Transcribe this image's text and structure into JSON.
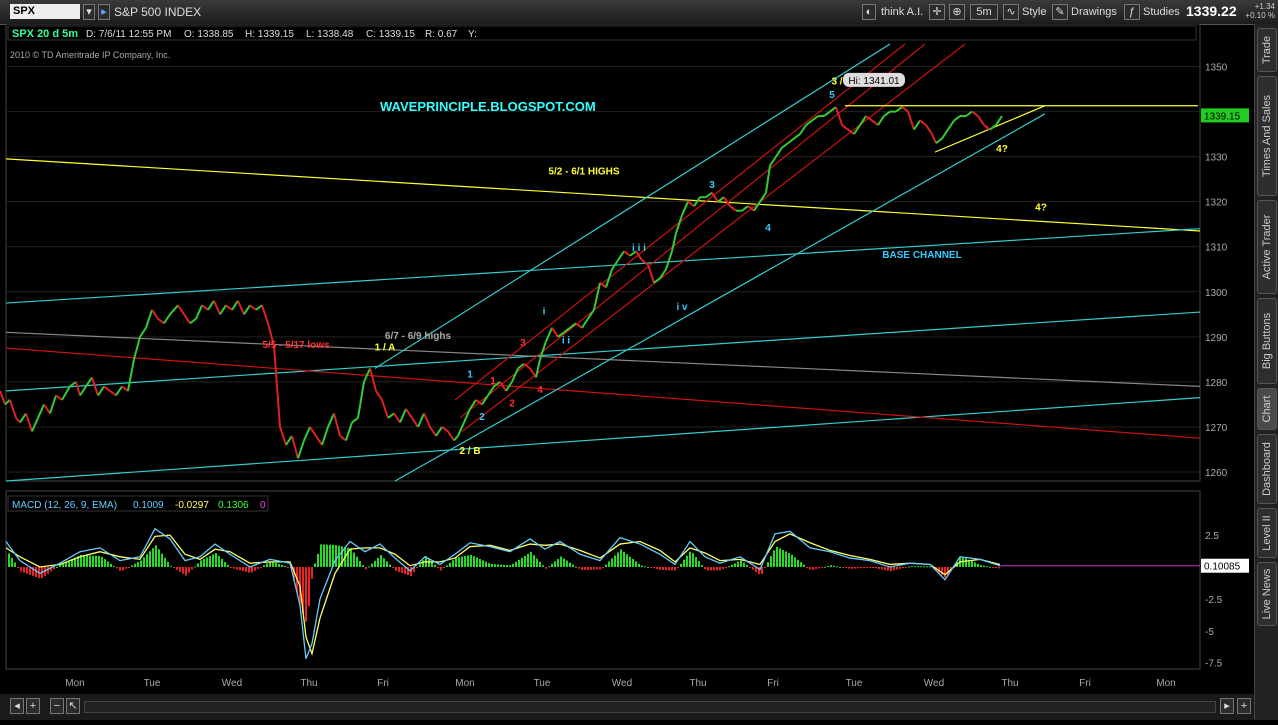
{
  "toolbar": {
    "symbol": "SPX",
    "name": "S&P 500 INDEX",
    "think": "think A.I.",
    "timeframe": "5m",
    "style": "Style",
    "drawings": "Drawings",
    "studies": "Studies",
    "last": "1339.22",
    "change": "+1.34",
    "change_pct": "+0.10 %"
  },
  "sidebar": {
    "tabs": [
      "Trade",
      "Times And Sales",
      "Active Trader",
      "Big Buttons",
      "Chart",
      "Dashboard",
      "Level II",
      "Live News"
    ]
  },
  "colors": {
    "price_up": "#33cc33",
    "price_down": "#dd2222",
    "cyan": "#33cccc",
    "yellow": "#ffff33",
    "red_channel": "#cc1111",
    "gray_line": "#888888",
    "macd_line": "#66ccff",
    "signal_line": "#ffff66",
    "hist_up": "#22dd22",
    "hist_down": "#ee2222",
    "grid": "#222222"
  },
  "chart_data": [
    {
      "type": "line",
      "header": {
        "symbol": "SPX 20 d 5m",
        "date": "D: 7/6/11 12:55 PM",
        "open": "O: 1338.85",
        "high": "H: 1339.15",
        "low": "L: 1338.48",
        "close": "C: 1339.15",
        "range": "R: 0.67",
        "y": "Y:"
      },
      "copyright": "2010 © TD Ameritrade IP Company, Inc.",
      "title": "WAVEPRINCIPLE.BLOGSPOT.COM",
      "x_labels": [
        "Mon",
        "Tue",
        "Wed",
        "Thu",
        "Fri",
        "Mon",
        "Tue",
        "Wed",
        "Thu",
        "Fri",
        "Tue",
        "Wed",
        "Thu",
        "Fri",
        "Mon"
      ],
      "ylim": [
        1258,
        1355
      ],
      "y_ticks": [
        1350,
        1340,
        1330,
        1320,
        1310,
        1300,
        1290,
        1280,
        1270,
        1260
      ],
      "current_price_label": "1339.15",
      "hi_label": "Hi: 1341.01",
      "x": [
        0,
        5,
        10,
        16,
        20,
        26,
        32,
        38,
        44,
        50,
        56,
        62,
        70,
        76,
        80,
        86,
        92,
        98,
        104,
        110,
        116,
        122,
        128,
        134,
        140,
        146,
        152,
        158,
        164,
        170,
        178,
        184,
        190,
        196,
        202,
        208,
        214,
        220,
        226,
        232,
        238,
        244,
        250,
        256,
        262,
        268,
        274,
        280,
        286,
        292,
        298,
        304,
        310,
        316,
        322,
        328,
        334,
        340,
        346,
        352,
        358,
        364,
        370,
        376,
        382,
        388,
        394,
        400,
        406,
        412,
        418,
        424,
        430,
        436,
        442,
        448,
        454,
        458,
        464,
        470,
        476,
        482,
        488,
        494,
        500,
        506,
        512,
        518,
        524,
        530,
        536,
        540,
        546,
        552,
        558,
        564,
        570,
        576,
        582,
        588,
        594,
        600,
        606,
        612,
        618,
        624,
        630,
        636,
        642,
        648,
        654,
        660,
        666,
        672,
        676,
        682,
        688,
        694,
        700,
        706,
        712,
        718,
        724,
        730,
        736,
        742,
        748,
        754,
        760,
        766,
        770,
        776,
        782,
        788,
        794,
        800,
        806,
        812,
        818,
        824,
        830,
        836,
        842,
        848,
        854,
        860,
        866,
        872,
        878,
        884,
        890,
        896,
        902,
        908,
        914,
        920,
        926,
        932,
        936,
        942,
        948,
        954,
        960,
        966,
        972,
        978,
        984,
        990,
        996,
        1002
      ],
      "values": [
        1278,
        1275,
        1276,
        1272,
        1271,
        1273,
        1269,
        1272,
        1275,
        1273,
        1277,
        1276,
        1279,
        1280,
        1277,
        1279,
        1281,
        1277,
        1279,
        1278,
        1277,
        1279,
        1278,
        1285,
        1290,
        1292,
        1296,
        1294,
        1293,
        1295,
        1297,
        1295,
        1293,
        1294,
        1297,
        1296,
        1298,
        1295,
        1297,
        1296,
        1298,
        1295,
        1297,
        1296,
        1297,
        1293,
        1288,
        1270,
        1266,
        1268,
        1263,
        1267,
        1270,
        1268,
        1266,
        1270,
        1273,
        1268,
        1267,
        1271,
        1272,
        1280,
        1283,
        1278,
        1276,
        1272,
        1273,
        1271,
        1274,
        1272,
        1270,
        1273,
        1270,
        1268,
        1270,
        1269,
        1267,
        1268,
        1271,
        1274,
        1276,
        1275,
        1277,
        1279,
        1280,
        1278,
        1280,
        1283,
        1284,
        1283,
        1281,
        1285,
        1289,
        1292,
        1290,
        1291,
        1292,
        1293,
        1292,
        1294,
        1296,
        1302,
        1301,
        1305,
        1307,
        1309,
        1308,
        1309,
        1307,
        1306,
        1302,
        1303,
        1305,
        1309,
        1313,
        1317,
        1320,
        1319,
        1321,
        1321,
        1322,
        1320,
        1321,
        1319,
        1318,
        1318,
        1319,
        1318,
        1320,
        1322,
        1328,
        1330,
        1332,
        1333,
        1334,
        1335,
        1337,
        1338,
        1339,
        1339,
        1340,
        1341,
        1337,
        1336,
        1335,
        1337,
        1339,
        1338,
        1337,
        1339,
        1340,
        1340,
        1341,
        1340,
        1336,
        1338,
        1337,
        1335,
        1333,
        1334,
        1336,
        1338,
        1339,
        1339,
        1340,
        1339,
        1337,
        1336,
        1337,
        1339
      ],
      "labels": [
        {
          "text": "5/5 - 5/17 lows",
          "color": "#ff3333",
          "x": 296,
          "v": 1287.5
        },
        {
          "text": "6/7 - 6/9 highs",
          "color": "#aaaaaa",
          "x": 418,
          "v": 1289.5
        },
        {
          "text": "1 / A",
          "color": "#ffff33",
          "x": 385,
          "v": 1287
        },
        {
          "text": "2 / B",
          "color": "#ffff33",
          "x": 470,
          "v": 1264
        },
        {
          "text": "3 / C",
          "color": "#ffff33",
          "x": 842,
          "v": 1346
        },
        {
          "text": "5",
          "color": "#33ccff",
          "x": 832,
          "v": 1343
        },
        {
          "text": "5/2 - 6/1 HIGHS",
          "color": "#ffff33",
          "x": 584,
          "v": 1326
        },
        {
          "text": "BASE CHANNEL",
          "color": "#33ccff",
          "x": 922,
          "v": 1307.5
        },
        {
          "text": "4?",
          "color": "#ffff33",
          "x": 1002,
          "v": 1331
        },
        {
          "text": "4?",
          "color": "#ffff33",
          "x": 1041,
          "v": 1318
        },
        {
          "text": "3",
          "color": "#33ccff",
          "x": 712,
          "v": 1323
        },
        {
          "text": "4",
          "color": "#33ccff",
          "x": 768,
          "v": 1313.5
        },
        {
          "text": "i i i",
          "color": "#33ccff",
          "x": 639,
          "v": 1309
        },
        {
          "text": "i v",
          "color": "#33ccff",
          "x": 682,
          "v": 1296
        },
        {
          "text": "i",
          "color": "#33ccff",
          "x": 544,
          "v": 1295
        },
        {
          "text": "i i",
          "color": "#33ccff",
          "x": 566,
          "v": 1288.5
        },
        {
          "text": "1",
          "color": "#33ccff",
          "x": 470,
          "v": 1281
        },
        {
          "text": "2",
          "color": "#33ccff",
          "x": 482,
          "v": 1271.5
        },
        {
          "text": "1",
          "color": "#ff3333",
          "x": 493,
          "v": 1279.5
        },
        {
          "text": "2",
          "color": "#ff3333",
          "x": 512,
          "v": 1274.5
        },
        {
          "text": "3",
          "color": "#ff3333",
          "x": 523,
          "v": 1288
        },
        {
          "text": "4",
          "color": "#ff3333",
          "x": 540,
          "v": 1277.5
        }
      ],
      "trendlines": [
        {
          "color": "#ffff33",
          "from": [
            6,
            1329.5
          ],
          "to": [
            1200,
            1313.5
          ]
        },
        {
          "color": "#33cccc",
          "from": [
            6,
            1297.5
          ],
          "to": [
            1200,
            1314
          ]
        },
        {
          "color": "#33cccc",
          "from": [
            6,
            1278
          ],
          "to": [
            1200,
            1295.5
          ]
        },
        {
          "color": "#33cccc",
          "from": [
            6,
            1258
          ],
          "to": [
            1200,
            1276.5
          ]
        },
        {
          "color": "#888888",
          "from": [
            6,
            1291
          ],
          "to": [
            1200,
            1279
          ]
        },
        {
          "color": "#cc1111",
          "from": [
            6,
            1287.5
          ],
          "to": [
            1200,
            1267.5
          ]
        },
        {
          "color": "#33cccc",
          "from": [
            395,
            1258
          ],
          "to": [
            1045,
            1339.5
          ]
        },
        {
          "color": "#33cccc",
          "from": [
            375,
            1283
          ],
          "to": [
            890,
            1355
          ]
        },
        {
          "color": "#cc1111",
          "from": [
            455,
            1276
          ],
          "to": [
            905,
            1355
          ]
        },
        {
          "color": "#cc1111",
          "from": [
            460,
            1272
          ],
          "to": [
            925,
            1355
          ]
        },
        {
          "color": "#cc1111",
          "from": [
            462,
            1269
          ],
          "to": [
            965,
            1355
          ]
        },
        {
          "color": "#ffff33",
          "from": [
            845,
            1341.3
          ],
          "to": [
            1198,
            1341.3
          ]
        },
        {
          "color": "#ffff33",
          "from": [
            935,
            1331
          ],
          "to": [
            1045,
            1341.3
          ]
        }
      ]
    },
    {
      "type": "bar",
      "title": "MACD (12, 26, 9, EMA)",
      "values_header": [
        "0.1009",
        "-0.0297",
        "0.1306",
        "0"
      ],
      "ylim": [
        -8,
        4
      ],
      "y_ticks": [
        "2.5",
        "0",
        "-2.5",
        "-5",
        "-7.5"
      ],
      "current_value_label": "0.10085",
      "macd_x": [
        6,
        20,
        40,
        60,
        80,
        100,
        120,
        140,
        155,
        170,
        185,
        200,
        215,
        230,
        250,
        270,
        290,
        300,
        306,
        312,
        320,
        335,
        350,
        365,
        380,
        395,
        410,
        425,
        440,
        455,
        470,
        490,
        510,
        530,
        545,
        560,
        580,
        600,
        620,
        640,
        660,
        675,
        690,
        705,
        720,
        740,
        760,
        775,
        790,
        810,
        830,
        850,
        870,
        890,
        910,
        930,
        945,
        960,
        980,
        1000
      ],
      "macd": [
        2,
        0.5,
        -0.5,
        0.3,
        1.2,
        1.5,
        0.5,
        0.8,
        3.0,
        2.2,
        0.5,
        0.8,
        1.8,
        1.0,
        0,
        0.6,
        0.3,
        -3,
        -7.2,
        -6,
        -2.5,
        0.5,
        2.0,
        1.2,
        1.8,
        0.7,
        -0.3,
        0.8,
        0.2,
        1.0,
        1.9,
        1.6,
        1.2,
        2.2,
        1.4,
        2.0,
        1.0,
        0.5,
        2.3,
        1.8,
        1.0,
        0.2,
        2.0,
        0.8,
        0.3,
        0.8,
        -0.2,
        2.6,
        2.8,
        1.5,
        1.2,
        0.7,
        0.5,
        0.0,
        0.3,
        0.2,
        -1.0,
        0.8,
        0.6,
        0.1
      ],
      "signal": [
        1.5,
        0.8,
        0,
        0.2,
        0.8,
        1.2,
        0.8,
        0.6,
        2.4,
        2.5,
        1.0,
        0.6,
        1.4,
        1.2,
        0.3,
        0.4,
        0.4,
        -1.5,
        -5.5,
        -6.8,
        -4,
        -0.5,
        1.4,
        1.5,
        1.5,
        1.0,
        0.1,
        0.4,
        0.4,
        0.7,
        1.6,
        1.7,
        1.3,
        1.8,
        1.7,
        1.8,
        1.3,
        0.7,
        1.8,
        2.0,
        1.3,
        0.4,
        1.5,
        1.1,
        0.5,
        0.6,
        0.2,
        2.0,
        2.6,
        1.9,
        1.3,
        0.9,
        0.6,
        0.2,
        0.3,
        0.2,
        -0.6,
        0.4,
        0.6,
        0.2
      ]
    }
  ]
}
